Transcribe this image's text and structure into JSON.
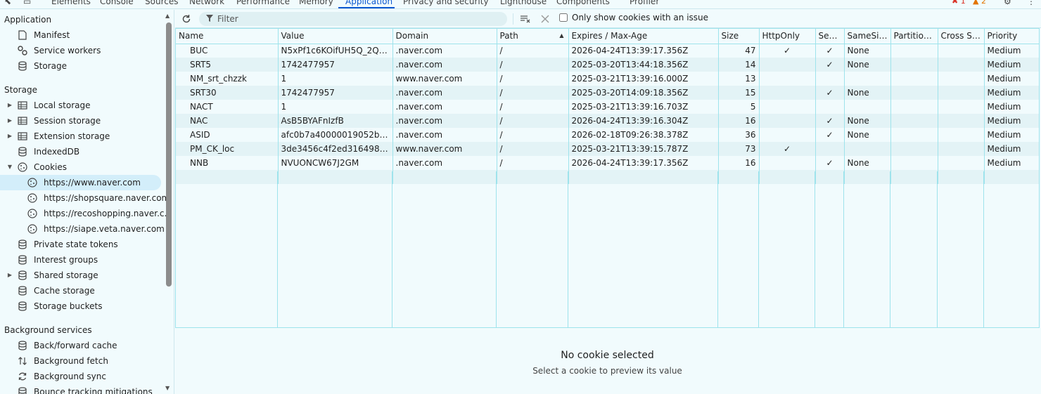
{
  "topbar": {
    "tabs": [
      "Elements",
      "Console",
      "Sources",
      "Network",
      "Performance",
      "Memory",
      "Application",
      "Privacy and security",
      "Lighthouse",
      "Components",
      "Profiler"
    ],
    "error_count": "1",
    "warning_count": "2"
  },
  "sidebar": {
    "application_header": "Application",
    "application_items": [
      "Manifest",
      "Service workers",
      "Storage"
    ],
    "storage_header": "Storage",
    "storage_items": [
      "Local storage",
      "Session storage",
      "Extension storage",
      "IndexedDB",
      "Cookies"
    ],
    "cookie_items": [
      "https://www.naver.com",
      "https://shopsquare.naver.com",
      "https://recoshopping.naver.c...",
      "https://siape.veta.naver.com"
    ],
    "storage_items_2": [
      "Private state tokens",
      "Interest groups",
      "Shared storage",
      "Cache storage",
      "Storage buckets"
    ],
    "background_header": "Background services",
    "background_items": [
      "Back/forward cache",
      "Background fetch",
      "Background sync",
      "Bounce tracking mitigations"
    ]
  },
  "toolbar": {
    "filter_placeholder": "Filter",
    "only_issue_label": "Only show cookies with an issue"
  },
  "table": {
    "columns": [
      "Name",
      "Value",
      "Domain",
      "Path",
      "Expires / Max-Age",
      "Size",
      "HttpOnly",
      "Sec...",
      "SameSite",
      "Partition...",
      "Cross Site",
      "Priority"
    ],
    "rows": [
      {
        "name": "BUC",
        "value": "N5xPf1c6KOifUH5Q_2QKF...",
        "domain": ".naver.com",
        "path": "/",
        "expires": "2026-04-24T13:39:17.356Z",
        "size": "47",
        "httponly": "✓",
        "secure": "✓",
        "samesite": "None",
        "partition": "",
        "cross": "",
        "priority": "Medium"
      },
      {
        "name": "SRT5",
        "value": "1742477957",
        "domain": ".naver.com",
        "path": "/",
        "expires": "2025-03-20T13:44:18.356Z",
        "size": "14",
        "httponly": "",
        "secure": "✓",
        "samesite": "None",
        "partition": "",
        "cross": "",
        "priority": "Medium"
      },
      {
        "name": "NM_srt_chzzk",
        "value": "1",
        "domain": "www.naver.com",
        "path": "/",
        "expires": "2025-03-21T13:39:16.000Z",
        "size": "13",
        "httponly": "",
        "secure": "",
        "samesite": "",
        "partition": "",
        "cross": "",
        "priority": "Medium"
      },
      {
        "name": "SRT30",
        "value": "1742477957",
        "domain": ".naver.com",
        "path": "/",
        "expires": "2025-03-20T14:09:18.356Z",
        "size": "15",
        "httponly": "",
        "secure": "✓",
        "samesite": "None",
        "partition": "",
        "cross": "",
        "priority": "Medium"
      },
      {
        "name": "NACT",
        "value": "1",
        "domain": ".naver.com",
        "path": "/",
        "expires": "2025-03-21T13:39:16.703Z",
        "size": "5",
        "httponly": "",
        "secure": "",
        "samesite": "",
        "partition": "",
        "cross": "",
        "priority": "Medium"
      },
      {
        "name": "NAC",
        "value": "AsB5BYAFnIzfB",
        "domain": ".naver.com",
        "path": "/",
        "expires": "2026-04-24T13:39:16.304Z",
        "size": "16",
        "httponly": "",
        "secure": "✓",
        "samesite": "None",
        "partition": "",
        "cross": "",
        "priority": "Medium"
      },
      {
        "name": "ASID",
        "value": "afc0b7a40000019052b45c...",
        "domain": ".naver.com",
        "path": "/",
        "expires": "2026-02-18T09:26:38.378Z",
        "size": "36",
        "httponly": "",
        "secure": "✓",
        "samesite": "None",
        "partition": "",
        "cross": "",
        "priority": "Medium"
      },
      {
        "name": "PM_CK_loc",
        "value": "3de3456c4f2ed316498e92...",
        "domain": "www.naver.com",
        "path": "/",
        "expires": "2025-03-21T13:39:15.787Z",
        "size": "73",
        "httponly": "✓",
        "secure": "",
        "samesite": "",
        "partition": "",
        "cross": "",
        "priority": "Medium"
      },
      {
        "name": "NNB",
        "value": "NVUONCW67J2GM",
        "domain": ".naver.com",
        "path": "/",
        "expires": "2026-04-24T13:39:17.356Z",
        "size": "16",
        "httponly": "",
        "secure": "✓",
        "samesite": "None",
        "partition": "",
        "cross": "",
        "priority": "Medium"
      }
    ]
  },
  "preview": {
    "title": "No cookie selected",
    "subtitle": "Select a cookie to preview its value"
  }
}
